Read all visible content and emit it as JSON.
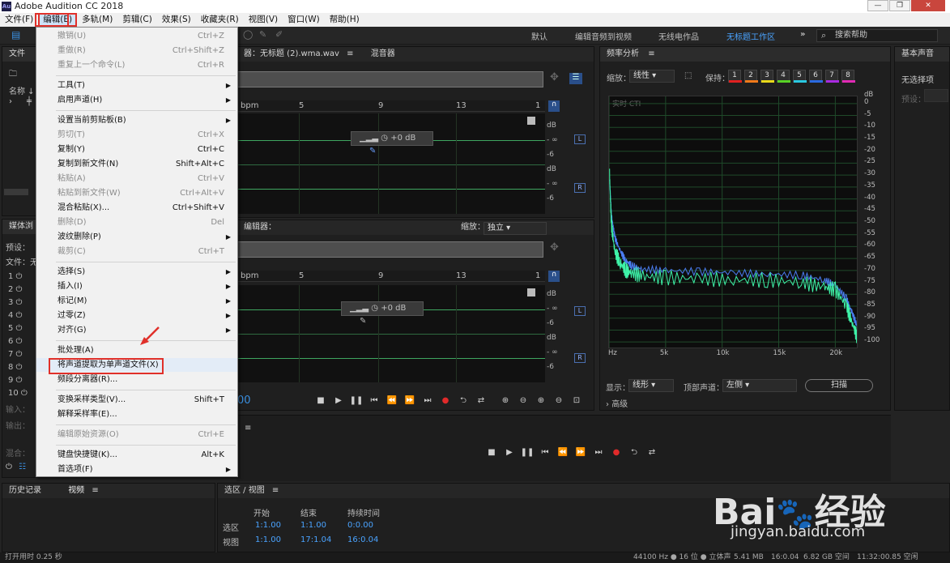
{
  "window": {
    "title": "Adobe Audition CC 2018",
    "icon": "Au"
  },
  "menubar": [
    "文件(F)",
    "编辑(E)",
    "多轨(M)",
    "剪辑(C)",
    "效果(S)",
    "收藏夹(R)",
    "视图(V)",
    "窗口(W)",
    "帮助(H)"
  ],
  "workspaces": {
    "items": [
      "默认",
      "编辑音频到视频",
      "无线电作品",
      "无标题工作区"
    ],
    "active": "无标题工作区",
    "more": "»"
  },
  "search": {
    "placeholder": "搜索帮助"
  },
  "edit_menu": {
    "items": [
      {
        "label": "撤销(U)",
        "shortcut": "Ctrl+Z",
        "disabled": true
      },
      {
        "label": "重做(R)",
        "shortcut": "Ctrl+Shift+Z",
        "disabled": true
      },
      {
        "label": "重复上一个命令(L)",
        "shortcut": "Ctrl+R",
        "disabled": true
      },
      {
        "label": "工具(T)",
        "submenu": true
      },
      {
        "label": "启用声道(H)",
        "submenu": true
      },
      {
        "label": "设置当前剪贴板(B)",
        "submenu": true
      },
      {
        "label": "剪切(T)",
        "shortcut": "Ctrl+X",
        "disabled": true
      },
      {
        "label": "复制(Y)",
        "shortcut": "Ctrl+C"
      },
      {
        "label": "复制到新文件(N)",
        "shortcut": "Shift+Alt+C"
      },
      {
        "label": "粘贴(A)",
        "shortcut": "Ctrl+V",
        "disabled": true
      },
      {
        "label": "粘贴到新文件(W)",
        "shortcut": "Ctrl+Alt+V",
        "disabled": true
      },
      {
        "label": "混合粘贴(X)...",
        "shortcut": "Ctrl+Shift+V"
      },
      {
        "label": "删除(D)",
        "shortcut": "Del",
        "disabled": true
      },
      {
        "label": "波纹删除(P)",
        "submenu": true
      },
      {
        "label": "裁剪(C)",
        "shortcut": "Ctrl+T",
        "disabled": true
      },
      {
        "label": "选择(S)",
        "submenu": true
      },
      {
        "label": "插入(I)",
        "submenu": true
      },
      {
        "label": "标记(M)",
        "submenu": true
      },
      {
        "label": "过零(Z)",
        "submenu": true
      },
      {
        "label": "对齐(G)",
        "submenu": true
      },
      {
        "label": "批处理(A)"
      },
      {
        "label": "将声道提取为单声道文件(X)",
        "highlighted": true
      },
      {
        "label": "频段分离器(R)..."
      },
      {
        "label": "变换采样类型(V)...",
        "shortcut": "Shift+T"
      },
      {
        "label": "解释采样率(E)..."
      },
      {
        "label": "编辑原始资源(O)",
        "shortcut": "Ctrl+E",
        "disabled": true
      },
      {
        "label": "键盘快捷键(K)...",
        "shortcut": "Alt+K"
      },
      {
        "label": "首选项(F)",
        "submenu": true
      }
    ]
  },
  "left_panel": {
    "files_tab": "文件",
    "files_tab2": "效",
    "name_col": "名称 ↓",
    "media_tab": "媒体浏",
    "preset": "预设：",
    "file": "文件：无",
    "input": "输入：",
    "output": "输出：",
    "mix": "混合：",
    "track_numbers": [
      "1",
      "2",
      "3",
      "4",
      "5",
      "6",
      "7",
      "8",
      "9",
      "10"
    ]
  },
  "editor": {
    "tab": "器：无标题 (2).wma.wav",
    "tab_mixer": "混音器",
    "ruler": [
      "bpm",
      "5",
      "9",
      "13",
      "1"
    ],
    "gain": "+0 dB",
    "db_labels": [
      "dB",
      "- ∞",
      "-6",
      "dB",
      "- ∞",
      "-6"
    ],
    "ch_l": "L",
    "ch_r": "R",
    "editor2_tab": "编辑器：",
    "zoom_label": "缩放：",
    "zoom_value": "独立",
    "timecode": "00"
  },
  "freq_panel": {
    "title": "频率分析",
    "scale_label": "缩放：",
    "scale_value": "线性",
    "hold_label": "保持：",
    "hold_numbers": [
      "1",
      "2",
      "3",
      "4",
      "5",
      "6",
      "7",
      "8"
    ],
    "hold_colors": [
      "#e02020",
      "#f07a1a",
      "#e8d81a",
      "#58d226",
      "#2ac8e0",
      "#2a6ae0",
      "#a82ae0",
      "#e02ab4"
    ],
    "live_cti": "实时 CTI",
    "display_label": "显示：",
    "display_value": "线形",
    "top_channel_label": "顶部声道：",
    "top_channel_value": "左侧",
    "scan_button": "扫描",
    "advanced": "高级"
  },
  "chart_data": {
    "type": "line",
    "title": "",
    "xlabel": "",
    "ylabel": "",
    "x_ticks": [
      "Hz",
      "5k",
      "10k",
      "15k",
      "20k"
    ],
    "y_ticks": [
      "dB",
      "0",
      "-5",
      "-10",
      "-15",
      "-20",
      "-25",
      "-30",
      "-35",
      "-40",
      "-45",
      "-50",
      "-55",
      "-60",
      "-65",
      "-70",
      "-75",
      "-80",
      "-85",
      "-90",
      "-95",
      "-100"
    ],
    "xlim": [
      0,
      22050
    ],
    "ylim": [
      -103,
      3
    ],
    "series": [
      {
        "color": "#4a7cf0",
        "x": [
          50,
          200,
          500,
          1000,
          1500,
          2000,
          3000,
          5000,
          8000,
          11000,
          14000,
          17000,
          19000,
          20000,
          21000,
          21500,
          22000
        ],
        "y": [
          -32,
          -46,
          -56,
          -62,
          -66,
          -68,
          -69.5,
          -70,
          -70.5,
          -71,
          -71.5,
          -72,
          -74,
          -76,
          -82,
          -88,
          -94
        ]
      },
      {
        "color": "#3ef2a8",
        "x": [
          50,
          200,
          500,
          1000,
          1500,
          2000,
          3000,
          5000,
          8000,
          11000,
          14000,
          17000,
          19000,
          20000,
          21000,
          21500,
          22000
        ],
        "y": [
          -30,
          -50,
          -62,
          -67,
          -70,
          -71,
          -72.5,
          -73,
          -73.5,
          -74,
          -74,
          -75,
          -77,
          -78,
          -85,
          -92,
          -99
        ]
      }
    ]
  },
  "right_panel": {
    "title": "基本声音",
    "no_selection": "无选择项",
    "preset": "预设："
  },
  "history": {
    "tab1": "历史记录",
    "tab2": "视频"
  },
  "selection_view": {
    "title": "选区 / 视图",
    "headers": [
      "开始",
      "结束",
      "持续时间"
    ],
    "rows": [
      {
        "label": "选区",
        "start": "1:1.00",
        "end": "1:1.00",
        "duration": "0:0.00"
      },
      {
        "label": "视图",
        "start": "1:1.00",
        "end": "17:1.04",
        "duration": "16:0.04"
      }
    ]
  },
  "statusbar": {
    "left": "打开用时 0.25 秒",
    "right": [
      "44100 Hz ● 16 位 ● 立体声",
      "5.41 MB",
      "16:0.04",
      "6.82 GB 空间",
      "11:32:00.85 空闲"
    ]
  },
  "watermark": {
    "brand": "Bai",
    "paw": "🐾",
    "brand2": "经验",
    "url": "jingyan.baidu.com"
  }
}
